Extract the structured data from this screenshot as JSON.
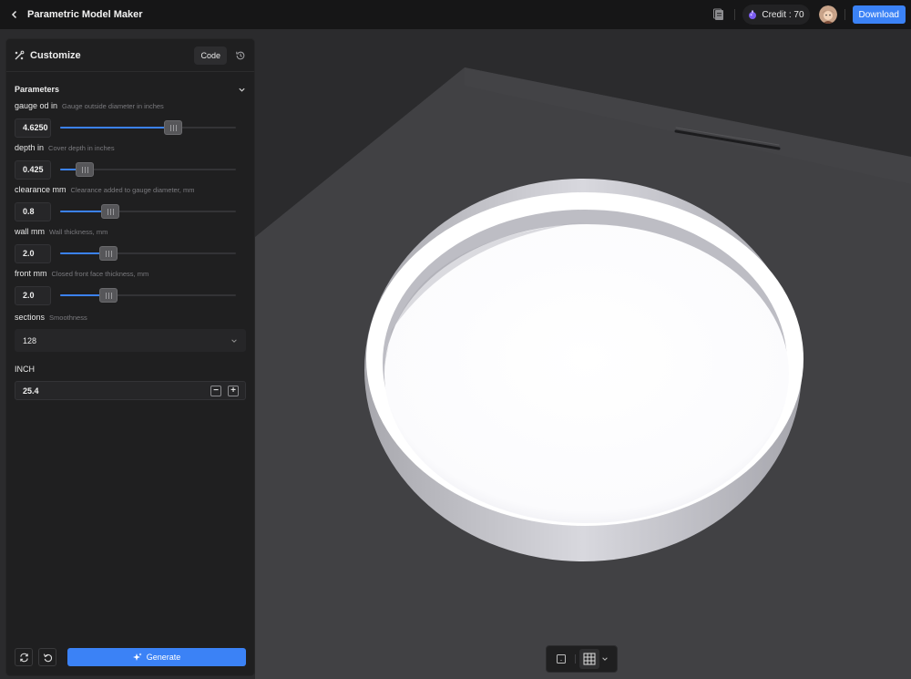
{
  "header": {
    "title": "Parametric Model Maker",
    "credit_label": "Credit : 70",
    "download_label": "Download"
  },
  "panel": {
    "title": "Customize",
    "code_label": "Code",
    "section_label": "Parameters",
    "params": [
      {
        "name": "gauge od in",
        "desc": "Gauge outside diameter in inches",
        "value": "4.6250",
        "level": 0.66
      },
      {
        "name": "depth in",
        "desc": "Cover depth in inches",
        "value": "0.425",
        "level": 0.1
      },
      {
        "name": "clearance mm",
        "desc": "Clearance added to gauge diameter, mm",
        "value": "0.8",
        "level": 0.26
      },
      {
        "name": "wall mm",
        "desc": "Wall thickness, mm",
        "value": "2.0",
        "level": 0.25
      },
      {
        "name": "front mm",
        "desc": "Closed front face thickness, mm",
        "value": "2.0",
        "level": 0.25
      }
    ],
    "sections": {
      "name": "sections",
      "desc": "Smoothness",
      "value": "128"
    },
    "inch": {
      "label": "INCH",
      "value": "25.4"
    },
    "generate_label": "Generate"
  },
  "colors": {
    "accent": "#3b82f6",
    "viewport_bg": "#2b2b2d",
    "panel_bg": "#1f1f20",
    "topbar_bg": "#161617"
  }
}
